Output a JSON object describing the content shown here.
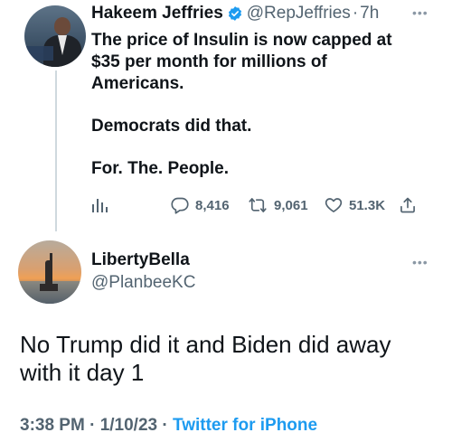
{
  "original_tweet": {
    "author_name": "Hakeem Jeffries",
    "handle": "@RepJeffries",
    "separator": "·",
    "time_ago": "7h",
    "text_lines": [
      "The price of Insulin is now capped at",
      "$35 per month for millions of",
      "Americans.",
      "",
      "Democrats did that.",
      "",
      "For. The. People."
    ],
    "stats": {
      "replies": "8,416",
      "retweets": "9,061",
      "likes": "51.3K"
    },
    "icons": {
      "verified": "verified-badge-icon",
      "analytics": "analytics-icon",
      "reply": "reply-icon",
      "retweet": "retweet-icon",
      "like": "heart-icon",
      "share": "share-icon",
      "more": "more-icon"
    }
  },
  "reply_tweet": {
    "author_name": "LibertyBella",
    "handle": "@PlanbeeKC",
    "text": "No Trump did it and Biden did away with it day 1",
    "time": "3:38 PM",
    "date": "1/10/23",
    "separator": "·",
    "source": "Twitter for iPhone"
  },
  "colors": {
    "text": "#0f1419",
    "muted": "#536471",
    "accent": "#1d9bf0",
    "thread_line": "#cfd9de"
  }
}
